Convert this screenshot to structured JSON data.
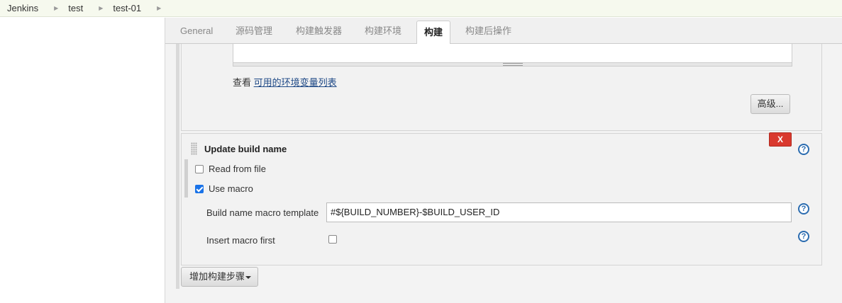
{
  "breadcrumb": {
    "items": [
      {
        "label": "Jenkins"
      },
      {
        "label": "test"
      },
      {
        "label": "test-01"
      }
    ]
  },
  "tabs": [
    {
      "label": "General"
    },
    {
      "label": "源码管理"
    },
    {
      "label": "构建触发器"
    },
    {
      "label": "构建环境"
    },
    {
      "label": "构建",
      "active": true
    },
    {
      "label": "构建后操作"
    }
  ],
  "env_section": {
    "view_prefix": "查看",
    "env_link": "可用的环境变量列表",
    "advanced_button": "高级..."
  },
  "update_build_name": {
    "title": "Update build name",
    "delete_label": "X",
    "read_from_file": {
      "label": "Read from file",
      "checked": false
    },
    "use_macro": {
      "label": "Use macro",
      "checked": true
    },
    "macro_template_label": "Build name macro template",
    "macro_template_value": "#${BUILD_NUMBER}-$BUILD_USER_ID",
    "insert_macro_first_label": "Insert macro first",
    "insert_macro_first_checked": false,
    "help_glyph": "?"
  },
  "add_build_step_label": "增加构建步骤",
  "icons": {
    "breadcrumb_separator": "▶",
    "help": "help-icon",
    "drag": "drag-handle-icon",
    "caret": "caret-down-icon"
  },
  "colors": {
    "breadcrumb_bg": "#f6f9ee",
    "delete_button": "#d9392e",
    "help_icon": "#2b6cb0",
    "checkbox_checked": "#1a73e8",
    "link": "#204a87"
  }
}
